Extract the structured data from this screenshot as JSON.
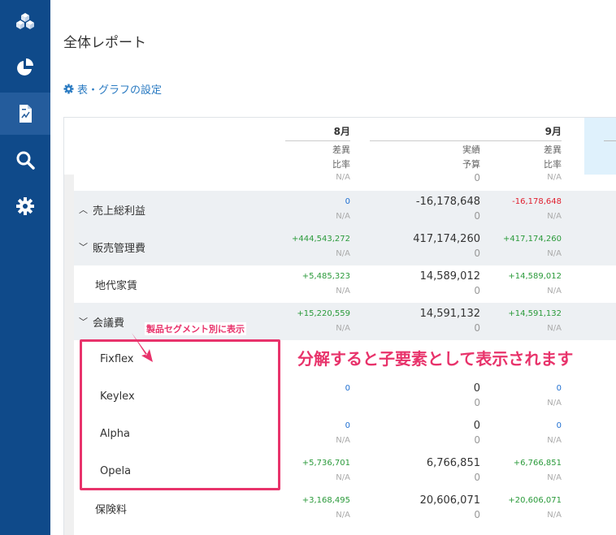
{
  "page": {
    "title": "全体レポート",
    "settings_label": "表・グラフの設定"
  },
  "sidebar": {
    "items": [
      {
        "icon": "cubes-icon",
        "active": false
      },
      {
        "icon": "pie-chart-icon",
        "active": false
      },
      {
        "icon": "report-document-icon",
        "active": true
      },
      {
        "icon": "search-icon",
        "active": false
      },
      {
        "icon": "gear-icon",
        "active": false
      }
    ]
  },
  "table": {
    "months": {
      "aug": "8月",
      "sep": "9月"
    },
    "aug_sub": {
      "line1": "差異",
      "line2": "比率"
    },
    "sep_mid_sub": {
      "line1": "実績",
      "line2": "予算"
    },
    "sep_sub": {
      "line1": "差異",
      "line2": "比率"
    },
    "partial_top": {
      "aug_bot": "N/A",
      "mid_bot": "0",
      "sep_bot": "N/A"
    },
    "rows": [
      {
        "label": "売上総利益",
        "chevron": "^",
        "aug_top": "0",
        "aug_bot": "N/A",
        "mid_top": "-16,178,648",
        "mid_bot": "0",
        "sep_top": "-16,178,648",
        "sep_bot": "N/A"
      },
      {
        "label": "販売管理費",
        "chevron": "v",
        "aug_top": "+444,543,272",
        "aug_bot": "N/A",
        "mid_top": "417,174,260",
        "mid_bot": "0",
        "sep_top": "+417,174,260",
        "sep_bot": "N/A"
      },
      {
        "label": "地代家賃",
        "chevron": "",
        "aug_top": "+5,485,323",
        "aug_bot": "N/A",
        "mid_top": "14,589,012",
        "mid_bot": "0",
        "sep_top": "+14,589,012",
        "sep_bot": "N/A"
      },
      {
        "label": "会議費",
        "chevron": "v",
        "aug_top": "+15,220,559",
        "aug_bot": "N/A",
        "mid_top": "14,591,132",
        "mid_bot": "0",
        "sep_top": "+14,591,132",
        "sep_bot": "N/A"
      },
      {
        "label": "Fixflex",
        "chevron": "",
        "aug_top": "",
        "aug_bot": "",
        "mid_top": "",
        "mid_bot": "",
        "sep_top": "",
        "sep_bot": ""
      },
      {
        "label": "Keylex",
        "chevron": "",
        "aug_top": "0",
        "aug_bot": "",
        "mid_top": "0",
        "mid_bot": "0",
        "sep_top": "0",
        "sep_bot": "N/A"
      },
      {
        "label": "Alpha",
        "chevron": "",
        "aug_top": "0",
        "aug_bot": "N/A",
        "mid_top": "0",
        "mid_bot": "0",
        "sep_top": "0",
        "sep_bot": "N/A"
      },
      {
        "label": "Opela",
        "chevron": "",
        "aug_top": "+5,736,701",
        "aug_bot": "N/A",
        "mid_top": "6,766,851",
        "mid_bot": "0",
        "sep_top": "+6,766,851",
        "sep_bot": "N/A"
      },
      {
        "label": "保険料",
        "chevron": "",
        "aug_top": "+3,168,495",
        "aug_bot": "N/A",
        "mid_top": "20,606,071",
        "mid_bot": "0",
        "sep_top": "+20,606,071",
        "sep_bot": "N/A"
      }
    ]
  },
  "annotations": {
    "small": "製品セグメント別に表示",
    "big": "分解すると子要素として表示されます"
  },
  "colors": {
    "sidebar": "#0f4a8a",
    "accent": "#2b7bc2",
    "positive": "#2a9a3a",
    "negative": "#e0202f",
    "zero": "#1f6fd1",
    "annotation": "#e8336b"
  }
}
